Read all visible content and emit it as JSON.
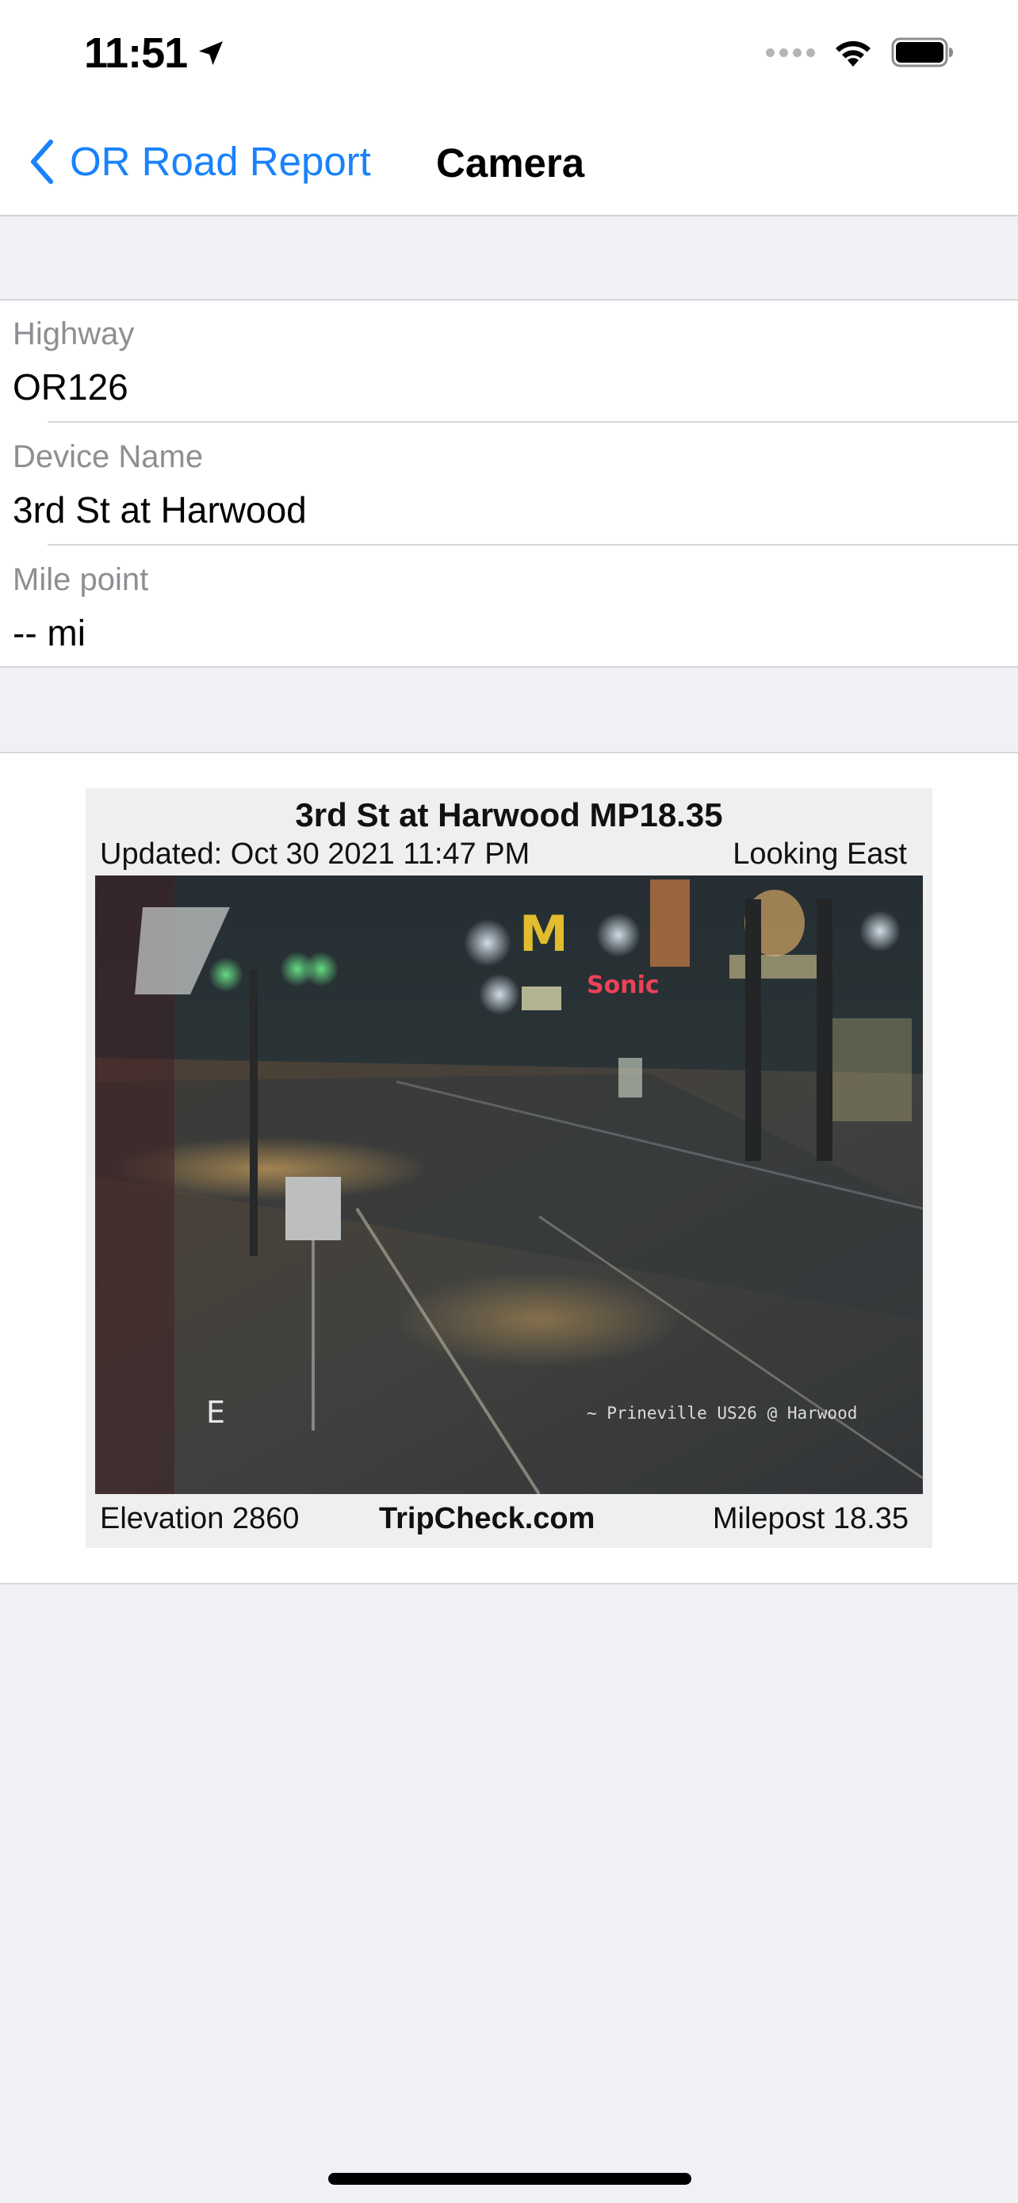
{
  "status_bar": {
    "time": "11:51",
    "icons": [
      "location-arrow-icon",
      "cellular-signal-icon",
      "wifi-icon",
      "battery-icon"
    ]
  },
  "nav": {
    "back_label": "OR Road Report",
    "title": "Camera"
  },
  "details": [
    {
      "label": "Highway",
      "value": "OR126"
    },
    {
      "label": "Device Name",
      "value": "3rd St at Harwood"
    },
    {
      "label": "Mile point",
      "value": "-- mi"
    }
  ],
  "camera": {
    "title": "3rd St at Harwood MP18.35",
    "updated": "Updated: Oct 30 2021  11:47 PM",
    "direction": "Looking East",
    "elevation": "Elevation 2860",
    "site": "TripCheck.com",
    "milepost": "Milepost 18.35",
    "overlay_text": "~ Prineville US26 @ Harwood",
    "overlay_letter": "E"
  },
  "colors": {
    "accent": "#1a82fb",
    "background": "#f0f0f5",
    "separator": "#d6d6da",
    "secondary_text": "#8e8e93"
  }
}
